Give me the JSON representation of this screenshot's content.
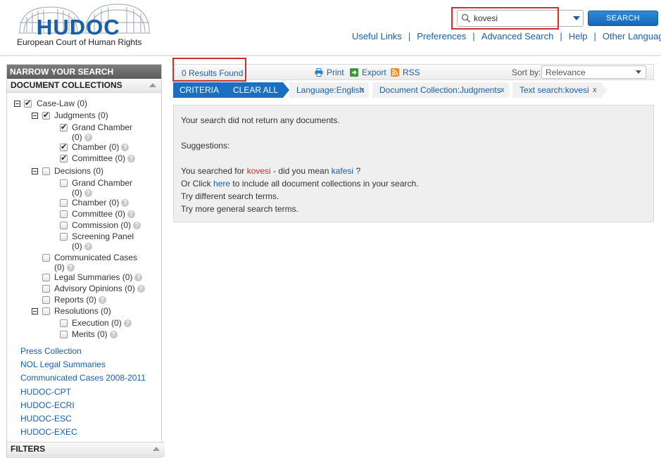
{
  "header": {
    "logo_title": "HUDOC",
    "logo_subtitle": "European Court of Human Rights",
    "search": {
      "value": "kovesi",
      "button_label": "SEARCH"
    },
    "nav": [
      "Useful Links",
      "Preferences",
      "Advanced Search",
      "Help",
      "Other Languages"
    ]
  },
  "sidebar": {
    "title": "NARROW YOUR SEARCH",
    "section_title": "DOCUMENT COLLECTIONS",
    "tree": {
      "case_law": "Case-Law (0)",
      "judgments": "Judgments (0)",
      "judgments_children": {
        "grand_chamber_1": "Grand Chamber",
        "grand_chamber_2": "(0)",
        "chamber": "Chamber (0)",
        "committee": "Committee (0)"
      },
      "decisions": "Decisions (0)",
      "decisions_children": {
        "grand_chamber_1": "Grand Chamber",
        "grand_chamber_2": "(0)",
        "chamber": "Chamber (0)",
        "committee": "Committee (0)",
        "commission": "Commission (0)",
        "screening_1": "Screening Panel",
        "screening_2": "(0)"
      },
      "communicated_1": "Communicated Cases",
      "communicated_2": "(0)",
      "legal_summaries": "Legal Summaries (0)",
      "advisory_opinions": "Advisory Opinions (0)",
      "reports": "Reports (0)",
      "resolutions": "Resolutions (0)",
      "resolutions_children": {
        "execution": "Execution (0)",
        "merits": "Merits (0)"
      }
    },
    "links": [
      "Press Collection",
      "NOL Legal Summaries",
      "Communicated Cases 2008-2011",
      "HUDOC-CPT",
      "HUDOC-ECRI",
      "HUDOC-ESC",
      "HUDOC-EXEC"
    ],
    "filters_title": "FILTERS",
    "help_glyph": "?"
  },
  "results": {
    "count": "0 Results Found",
    "print": "Print",
    "export": "Export",
    "rss": "RSS",
    "sort_label": "Sort by:",
    "sort_value": "Relevance"
  },
  "criteria": {
    "label": "CRITERIA",
    "clear_all": "CLEAR ALL",
    "crumbs": [
      "Language:English",
      "Document Collection:Judgments",
      "Text search:kovesi"
    ],
    "remove_glyph": "x"
  },
  "message": {
    "line1": "Your search did not return any documents.",
    "line2": "Suggestions:",
    "searched_prefix": "You searched for",
    "searched_term": "kovesi",
    "did_you_mean": "- did you mean",
    "suggestion": "kafesi",
    "question_mark": "?",
    "click_prefix": "Or Click",
    "click_link": "here",
    "click_suffix": "to include all document collections in your search.",
    "line5": "Try different search terms.",
    "line6": "Try more general search terms."
  },
  "colors": {
    "brand_blue": "#1a6fc0",
    "link_blue": "#1a5ea8",
    "highlight_red": "#d32f2f"
  }
}
